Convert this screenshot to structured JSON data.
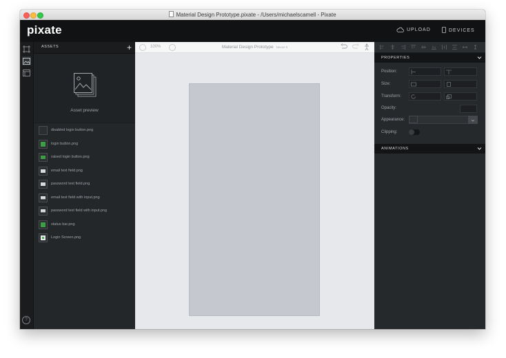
{
  "window": {
    "title": "Material Design Prototype.pixate - /Users/michaelscamell - Pixate"
  },
  "appbar": {
    "logo": "pixate",
    "upload_label": "UPLOAD",
    "devices_label": "DEVICES"
  },
  "rail": {
    "icons": [
      "layers-icon",
      "image-icon",
      "component-icon"
    ],
    "help_glyph": "?"
  },
  "assets": {
    "header": "ASSETS",
    "add_glyph": "+",
    "preview_label": "Asset preview",
    "items": [
      {
        "label": "disabled login button.png",
        "thumb": "dark-button"
      },
      {
        "label": "login button.png",
        "thumb": "green"
      },
      {
        "label": "raised login button.png",
        "thumb": "green-raised"
      },
      {
        "label": "email text field.png",
        "thumb": "text-field"
      },
      {
        "label": "password text field.png",
        "thumb": "text-field"
      },
      {
        "label": "email text field with input.png",
        "thumb": "text-field-input"
      },
      {
        "label": "password text field with input.png",
        "thumb": "text-field-input"
      },
      {
        "label": "status bar.png",
        "thumb": "green"
      },
      {
        "label": "Login Screen.png",
        "thumb": "screen"
      }
    ]
  },
  "canvas": {
    "zoom": "100%",
    "project_title": "Material Design Prototype",
    "project_meta": "Nexus 5"
  },
  "properties": {
    "header": "PROPERTIES",
    "position_label": "Position:",
    "size_label": "Size:",
    "transform_label": "Transform:",
    "opacity_label": "Opacity:",
    "opacity_value": 1,
    "appearance_label": "Appearance:",
    "clipping_label": "Clipping:",
    "clipping_on": false
  },
  "animations": {
    "header": "ANIMATIONS"
  },
  "colors": {
    "appbar": "#111213",
    "panel": "#26292c",
    "canvas": "#e6e8eb",
    "artboard": "#c5c9cf",
    "asset_green": "#3aa043"
  }
}
